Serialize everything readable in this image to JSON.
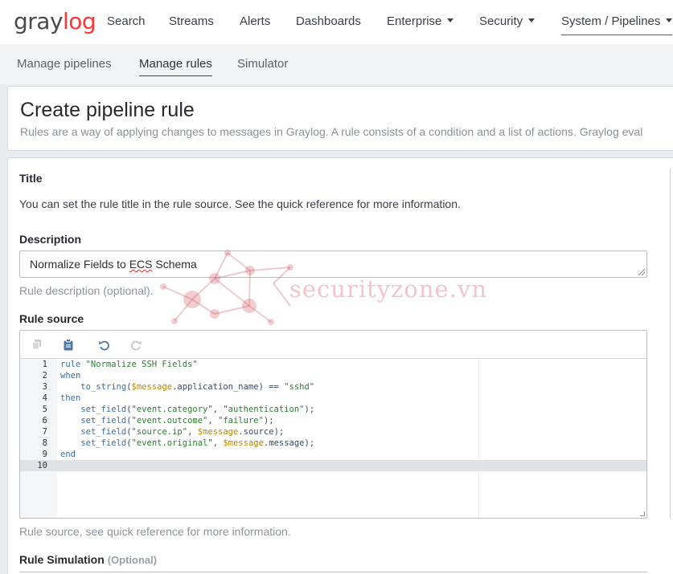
{
  "brand": {
    "logo_prefix": "gray",
    "logo_accent": "log",
    "accent_color": "#ff3633"
  },
  "topnav": {
    "items": [
      {
        "label": "Search"
      },
      {
        "label": "Streams"
      },
      {
        "label": "Alerts"
      },
      {
        "label": "Dashboards"
      },
      {
        "label": "Enterprise"
      },
      {
        "label": "Security"
      },
      {
        "label": "System / Pipelines"
      }
    ]
  },
  "subnav": {
    "items": [
      {
        "label": "Manage pipelines"
      },
      {
        "label": "Manage rules"
      },
      {
        "label": "Simulator"
      }
    ]
  },
  "header": {
    "title": "Create pipeline rule",
    "description": "Rules are a way of applying changes to messages in Graylog. A rule consists of a condition and a list of actions. Graylog eval"
  },
  "form": {
    "title_label": "Title",
    "title_help": "You can set the rule title in the rule source. See the quick reference for more information.",
    "description_label": "Description",
    "description_value_plain": "Normalize Fields to ",
    "description_value_marked": "ECS",
    "description_value_rest": " Schema",
    "description_help": "Rule description (optional).",
    "source_label": "Rule source",
    "source_help": "Rule source, see quick reference for more information.",
    "simulation_label": "Rule Simulation",
    "simulation_optional": "(Optional)"
  },
  "editor": {
    "line_numbers": [
      "1",
      "2",
      "3",
      "4",
      "5",
      "6",
      "7",
      "8",
      "9",
      "10"
    ],
    "lines": [
      [
        {
          "t": "kw",
          "v": "rule "
        },
        {
          "t": "str",
          "v": "\"Normalize SSH Fields\""
        }
      ],
      [
        {
          "t": "kw",
          "v": "when"
        }
      ],
      [
        {
          "t": "p",
          "v": "    "
        },
        {
          "t": "fn",
          "v": "to_string"
        },
        {
          "t": "p",
          "v": "("
        },
        {
          "t": "var",
          "v": "$message"
        },
        {
          "t": "p",
          "v": ".application_name) == "
        },
        {
          "t": "str",
          "v": "\"sshd\""
        }
      ],
      [
        {
          "t": "kw",
          "v": "then"
        }
      ],
      [
        {
          "t": "p",
          "v": "    "
        },
        {
          "t": "fn",
          "v": "set_field"
        },
        {
          "t": "p",
          "v": "("
        },
        {
          "t": "str",
          "v": "\"event.category\""
        },
        {
          "t": "p",
          "v": ", "
        },
        {
          "t": "str",
          "v": "\"authentication\""
        },
        {
          "t": "p",
          "v": ");"
        }
      ],
      [
        {
          "t": "p",
          "v": "    "
        },
        {
          "t": "fn",
          "v": "set_field"
        },
        {
          "t": "p",
          "v": "("
        },
        {
          "t": "str",
          "v": "\"event.outcome\""
        },
        {
          "t": "p",
          "v": ", "
        },
        {
          "t": "str",
          "v": "\"failure\""
        },
        {
          "t": "p",
          "v": ");"
        }
      ],
      [
        {
          "t": "p",
          "v": "    "
        },
        {
          "t": "fn",
          "v": "set_field"
        },
        {
          "t": "p",
          "v": "("
        },
        {
          "t": "str",
          "v": "\"source.ip\""
        },
        {
          "t": "p",
          "v": ", "
        },
        {
          "t": "var",
          "v": "$message"
        },
        {
          "t": "p",
          "v": ".source);"
        }
      ],
      [
        {
          "t": "p",
          "v": "    "
        },
        {
          "t": "fn",
          "v": "set_field"
        },
        {
          "t": "p",
          "v": "("
        },
        {
          "t": "str",
          "v": "\"event.original\""
        },
        {
          "t": "p",
          "v": ", "
        },
        {
          "t": "var",
          "v": "$message"
        },
        {
          "t": "p",
          "v": ".message);"
        }
      ],
      [
        {
          "t": "kw",
          "v": "end"
        }
      ],
      []
    ],
    "toolbar_icons": [
      "copy-icon",
      "paste-icon",
      "undo-icon",
      "redo-icon"
    ]
  },
  "watermark": {
    "text": "securityzone.vn"
  }
}
